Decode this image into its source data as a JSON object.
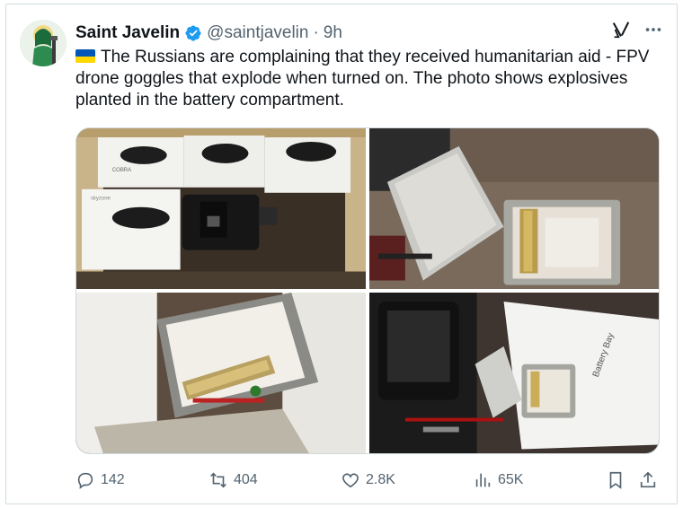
{
  "author": {
    "name": "Saint Javelin",
    "handle": "@saintjavelin",
    "separator": "·",
    "time": "9h"
  },
  "tweet": {
    "text": "The Russians are complaining that they received humanitarian aid - FPV drone goggles that explode when turned on. The photo shows explosives planted in the battery compartment.",
    "flag_icon": "ukraine-flag-icon"
  },
  "media": {
    "photo1_box_label": "COBRA",
    "photo1_box_brand": "skyzone",
    "photo4_box_text": "Battery Bay"
  },
  "actions": {
    "replies": "142",
    "reposts": "404",
    "likes": "2.8K",
    "views": "65K"
  },
  "icons": {
    "grok": "grok-icon",
    "more": "more-icon",
    "reply": "reply-icon",
    "repost": "repost-icon",
    "like": "like-icon",
    "views": "views-icon",
    "bookmark": "bookmark-icon",
    "share": "share-icon"
  },
  "colors": {
    "verified": "#1d9bf0",
    "text": "#0f1419",
    "secondary": "#536471",
    "border": "#cfd9de"
  }
}
